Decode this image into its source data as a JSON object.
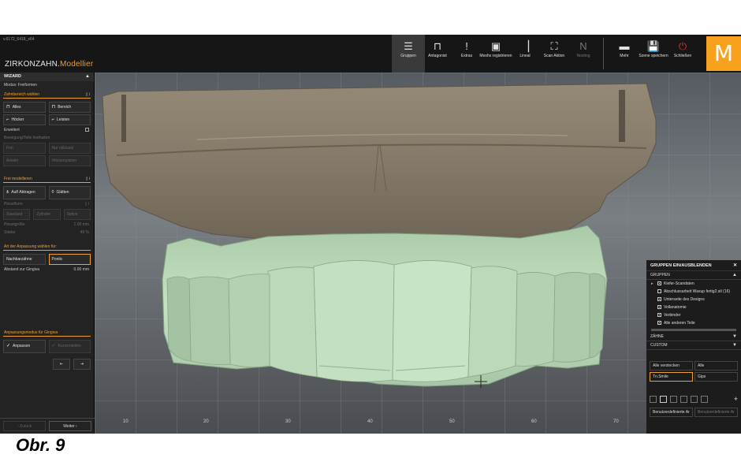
{
  "app": {
    "version": "v.6172_6418_x64",
    "brand_main": "ZIRKONZAHN.",
    "brand_sub": "Modellier",
    "logo_letter": "M"
  },
  "toolbar": {
    "items": [
      {
        "label": "Gruppen",
        "icon": "list-icon"
      },
      {
        "label": "Antagonist",
        "icon": "antagonist-icon"
      },
      {
        "label": "Extras",
        "icon": "exclamation-icon"
      },
      {
        "label": "Meshs registrieren",
        "icon": "register-mesh-icon"
      },
      {
        "label": "Lineal",
        "icon": "ruler-icon"
      },
      {
        "label": "Scan Aktion",
        "icon": "scan-icon"
      },
      {
        "label": "Nesting",
        "icon": "nesting-icon"
      },
      {
        "label": "Mehr",
        "icon": "more-icon"
      },
      {
        "label": "Szene speichern",
        "icon": "save-icon"
      },
      {
        "label": "Schließen",
        "icon": "power-icon"
      }
    ]
  },
  "left_panel": {
    "title": "WIZARD",
    "mode": "Modus: Freiformen",
    "section_zahnbereich": "Zahnbereich wählen",
    "btn_alles": "Alles",
    "btn_bereich": "Bereich",
    "btn_hoecker": "Höcker",
    "btn_leisten": "Leisten",
    "erweitert": "Erweitert",
    "bewegung": "Bewegung/Teile festhalten",
    "btn_frei": "Frei",
    "btn_nur_okklusal": "Nur okklusal",
    "btn_axial": "Axialer",
    "btn_hoeckerspitzen": "Höckerspitzen",
    "section_frei": "Frei modellieren",
    "btn_auftragen": "Auf/ Abtragen",
    "btn_glaetten": "Glätten",
    "pinselform": "Pinselform",
    "btn_standard": "Standard",
    "btn_zylinder": "Zylinder",
    "btn_spitze": "Spitze",
    "pinselgroesse": "Pinselgröße",
    "pinselgroesse_val": "1.00 mm",
    "staerke": "Stärke",
    "staerke_val": "49 %",
    "section_anpassung": "Art der Anpassung wählen für:",
    "btn_nachbarzaehne": "Nachbarzähne",
    "btn_pontic": "Pontic",
    "abstand": "Abstand zur Gingiva",
    "abstand_val": "0.00 mm",
    "section_gingiva": "Anpassungsmodus für Gingiva",
    "btn_anpassen": "Anpassen",
    "btn_kurzerstellen": "Kurzerstellen",
    "nav_back": "Zurück",
    "nav_next": "Weiter"
  },
  "right_panel": {
    "title": "GRUPPEN EIN/AUSBLENDEN",
    "section_gruppen": "GRUPPEN",
    "items": [
      {
        "label": "Kiefer-Scandaten",
        "checked": true
      },
      {
        "label": "Abschlussarbeit Waxup fertig2.stl (16)",
        "checked": false
      },
      {
        "label": "Unterseite des Designs",
        "checked": true
      },
      {
        "label": "Vollanatomie",
        "checked": true
      },
      {
        "label": "Verbinder",
        "checked": true
      },
      {
        "label": "Alle anderen Teile",
        "checked": true
      }
    ],
    "section_zaehne": "ZÄHNE",
    "section_custom": "CUSTOM",
    "btn_alle_verstecken": "Alle verstecken",
    "btn_alle": "Alle",
    "btn_tn_smile": "Tn.Smile",
    "btn_gips": "Gips",
    "btn_benutzer1": "Benutzerdefinierte Ar",
    "btn_benutzer2": "Benutzerdefinierte Ar"
  },
  "viewport": {
    "ruler_ticks": [
      "10",
      "20",
      "30",
      "40",
      "50",
      "60",
      "70"
    ],
    "colors": {
      "stone": "#8b7f6e",
      "teeth": "#b9d8b8"
    }
  },
  "caption": "Obr. 9"
}
